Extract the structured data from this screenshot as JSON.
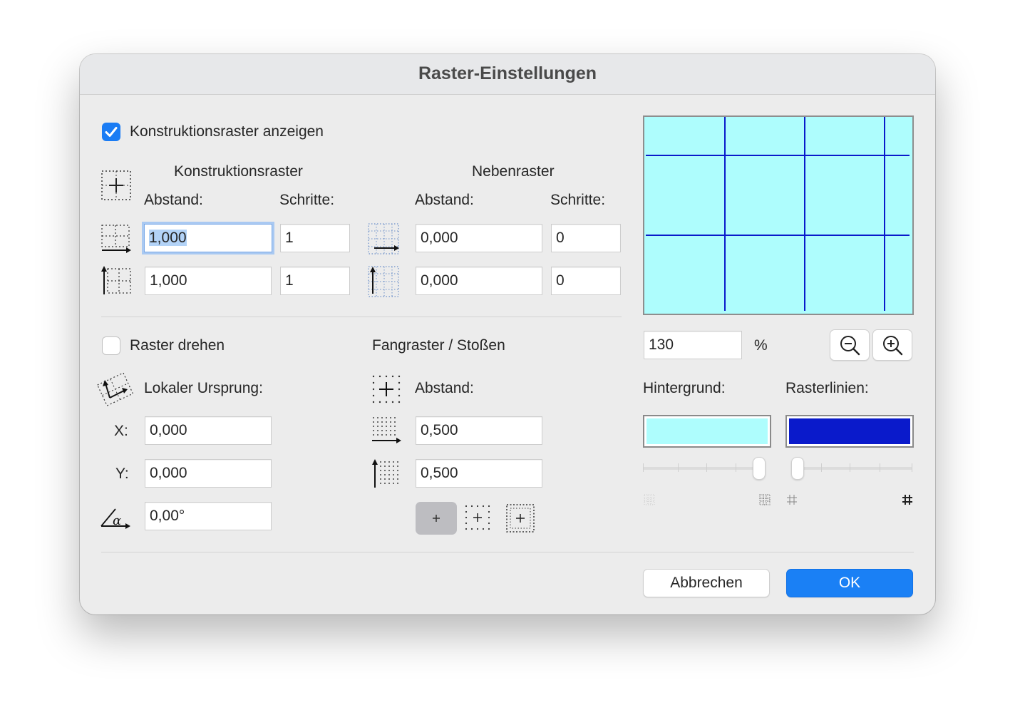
{
  "dialog": {
    "title": "Raster-Einstellungen",
    "show_grid": {
      "label": "Konstruktionsraster anzeigen",
      "checked": true
    },
    "construction_grid": {
      "heading": "Konstruktionsraster",
      "spacing_label": "Abstand:",
      "steps_label": "Schritte:",
      "x_spacing": "1,000",
      "x_steps": "1",
      "y_spacing": "1,000",
      "y_steps": "1"
    },
    "secondary_grid": {
      "heading": "Nebenraster",
      "spacing_label": "Abstand:",
      "steps_label": "Schritte:",
      "x_spacing": "0,000",
      "x_steps": "0",
      "y_spacing": "0,000",
      "y_steps": "0"
    },
    "rotate_grid": {
      "label": "Raster drehen",
      "checked": false,
      "origin_label": "Lokaler Ursprung:",
      "x_label": "X:",
      "x_value": "0,000",
      "y_label": "Y:",
      "y_value": "0,000",
      "angle_value": "0,00°"
    },
    "snap_grid": {
      "heading": "Fangraster / Stoßen",
      "spacing_label": "Abstand:",
      "x_spacing": "0,500",
      "y_spacing": "0,500",
      "selected_mode": 0
    },
    "preview": {
      "zoom_value": "130",
      "zoom_unit": "%",
      "background_label": "Hintergrund:",
      "gridlines_label": "Rasterlinien:",
      "background_color": "#aefdfd",
      "gridline_color": "#0a1acb",
      "background_slider": 1.0,
      "gridline_slider": 0.0
    },
    "buttons": {
      "cancel": "Abbrechen",
      "ok": "OK"
    }
  }
}
